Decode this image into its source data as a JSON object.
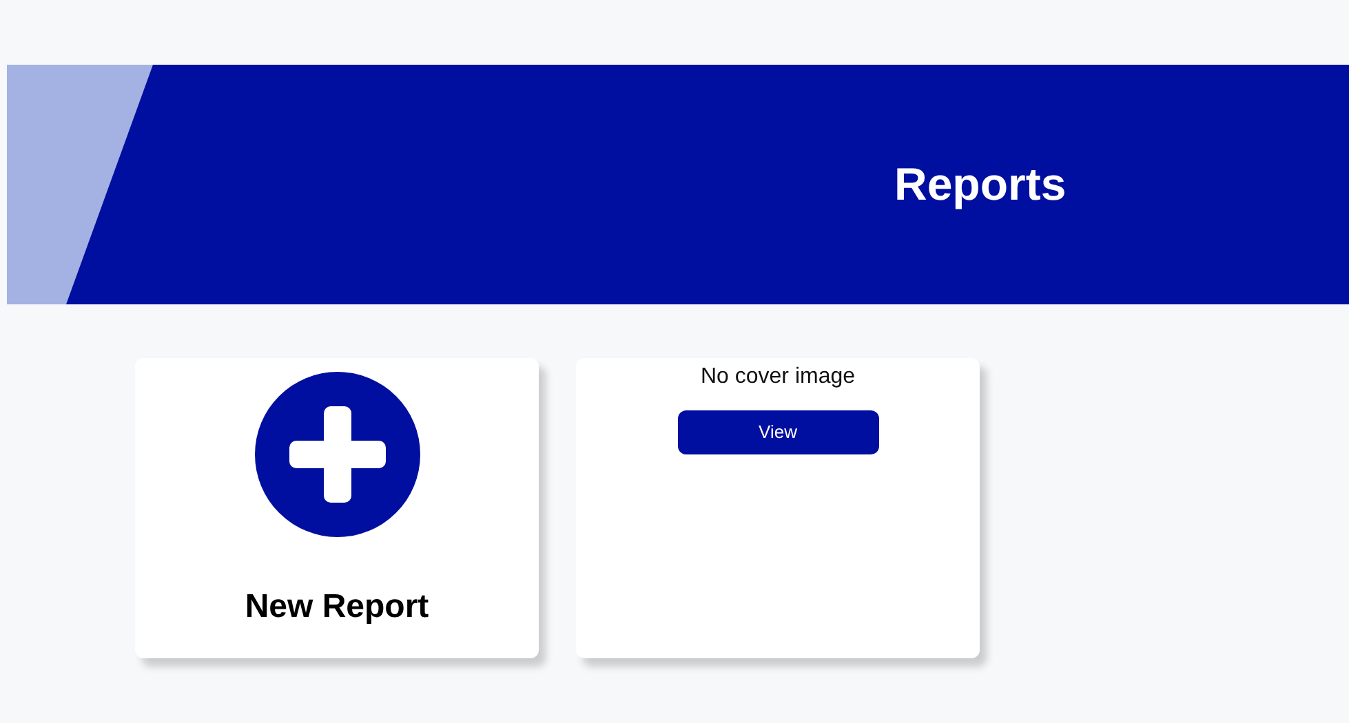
{
  "header": {
    "title": "Reports"
  },
  "cards": [
    {
      "kind": "new",
      "label": "New Report"
    },
    {
      "kind": "report",
      "caption": "No cover image",
      "button": "View"
    }
  ]
}
